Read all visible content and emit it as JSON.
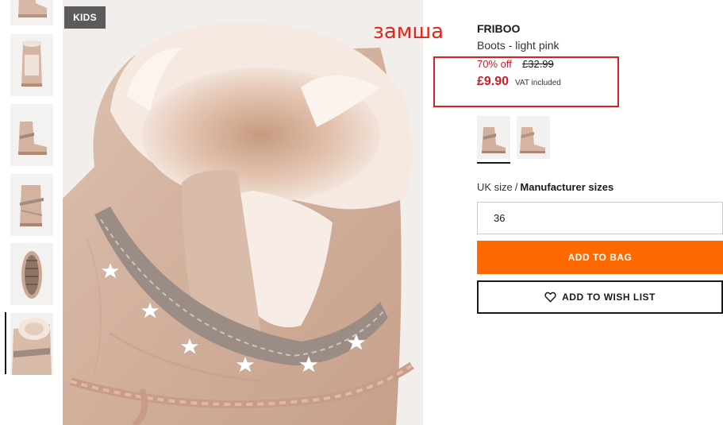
{
  "product": {
    "badge": "KIDS",
    "brand": "FRIBOO",
    "name": "Boots - light pink",
    "discount": "70% off",
    "old_price": "£32.99",
    "price": "£9.90",
    "vat": "VAT included"
  },
  "annotation": {
    "text": "замша",
    "color": "#e2261c"
  },
  "thumbnails": {
    "count": 6,
    "selected_index": 5,
    "icons": [
      "boot-side-icon",
      "boot-open-icon",
      "boot-front-icon",
      "boot-back-icon",
      "boot-sole-icon",
      "boot-fur-closeup-icon"
    ]
  },
  "swatches": {
    "selected_index": 0,
    "icons": [
      "boot-swatch-icon",
      "boot-swatch-icon"
    ]
  },
  "size": {
    "label_uk": "UK size",
    "separator": "/",
    "label_manufacturer": "Manufacturer sizes",
    "value": "36"
  },
  "buttons": {
    "add_to_bag": "ADD TO BAG",
    "add_to_wishlist": "ADD TO WISH LIST"
  },
  "colors": {
    "accent": "#ff6900",
    "sale_red": "#cd1d28",
    "badge_bg": "#5b5b5b",
    "boot_suede": "#d7b8a6",
    "fur": "#f3e6dd"
  }
}
